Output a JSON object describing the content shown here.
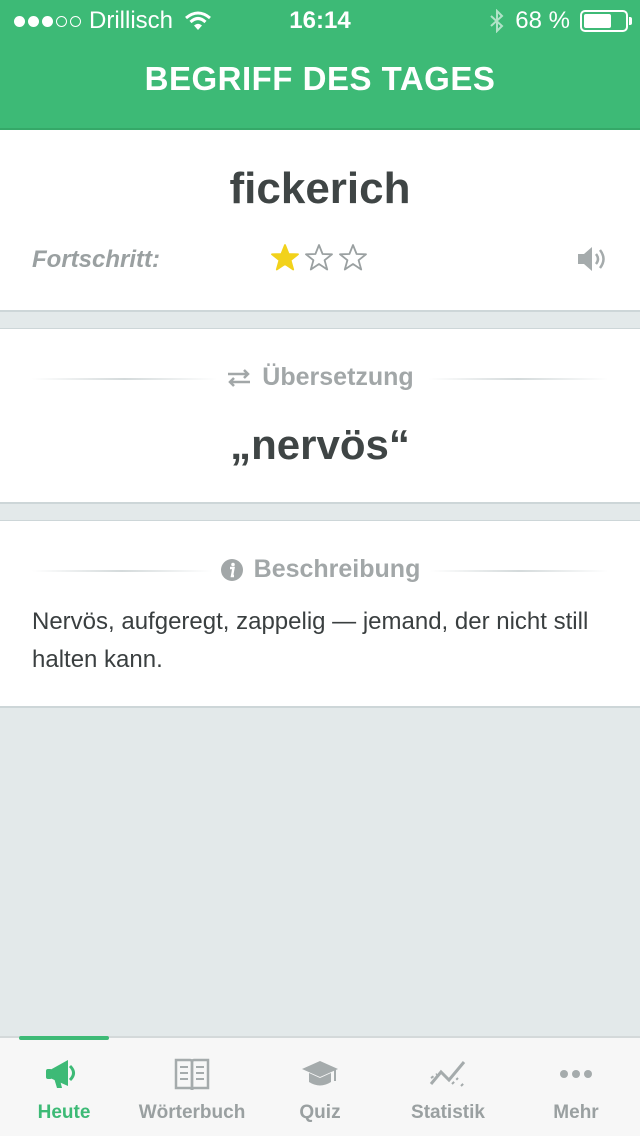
{
  "status_bar": {
    "carrier": "Drillisch",
    "signal_filled": 3,
    "signal_total": 5,
    "time": "16:14",
    "battery_text": "68 %",
    "battery_level": 0.68
  },
  "header": {
    "title": "BEGRIFF DES TAGES"
  },
  "term": {
    "word": "fickerich",
    "progress_label": "Fortschritt:",
    "progress_stars_filled": 1,
    "progress_stars_total": 3,
    "audio_icon": "speaker-icon"
  },
  "translation": {
    "heading": "Übersetzung",
    "icon": "swap-arrows-icon",
    "text": "„nervös“"
  },
  "description": {
    "heading": "Beschreibung",
    "icon": "info-icon",
    "text": "Nervös, aufgeregt, zappelig — jemand, der nicht still halten kann."
  },
  "tabs": [
    {
      "label": "Heute",
      "icon": "megaphone-icon",
      "active": true
    },
    {
      "label": "Wörterbuch",
      "icon": "book-icon",
      "active": false
    },
    {
      "label": "Quiz",
      "icon": "graduation-cap-icon",
      "active": false
    },
    {
      "label": "Statistik",
      "icon": "chart-line-icon",
      "active": false
    },
    {
      "label": "Mehr",
      "icon": "more-dots-icon",
      "active": false
    }
  ],
  "colors": {
    "accent": "#3dba76",
    "star_filled": "#f2d21b",
    "background": "#e3e9ea"
  }
}
